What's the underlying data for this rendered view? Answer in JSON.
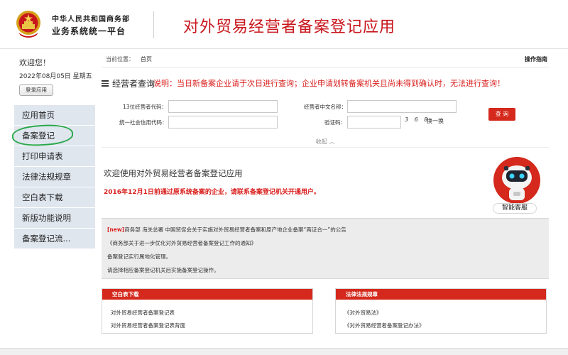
{
  "header": {
    "org_line1": "中华人民共和国商务部",
    "org_line2": "业务系统统一平台",
    "app_title": "对外贸易经营者备案登记应用"
  },
  "sidebar": {
    "welcome": "欢迎您！",
    "date": "2022年08月05日 星期五",
    "login_label": "登录应用",
    "items": [
      {
        "label": "应用首页"
      },
      {
        "label": "备案登记"
      },
      {
        "label": "打印申请表"
      },
      {
        "label": "法律法规规章"
      },
      {
        "label": "空白表下载"
      },
      {
        "label": "新版功能说明"
      },
      {
        "label": "备案登记流..."
      }
    ]
  },
  "breadcrumb": {
    "label": "当前位置：",
    "current": "首页",
    "guide": "操作指南"
  },
  "query": {
    "title": "经营者查询",
    "note": "说明：当日新备案企业请于次日进行查询；企业申请划转备案机关且尚未得到确认时，无法进行查询！",
    "fields": {
      "code13_label": "13位经营者代码：",
      "cn_name_label": "经营者中文名称：",
      "credit_code_label": "统一社会信用代码：",
      "captcha_label": "验证码："
    },
    "captcha_text": "3 6 8",
    "refresh_label": "换一换",
    "search_label": "查 询",
    "collapse_label": "收起 ︿"
  },
  "notice": {
    "title": "欢迎使用对外贸易经营者备案登记应用",
    "red_text": "2016年12月1日前通过原系统备案的企业，请联系备案登记机关开通用户。"
  },
  "assistant": {
    "label": "智能客服"
  },
  "news": {
    "new_tag": "[new]",
    "line1_text": "商务部 海关总署 中国贸促会关于实施对外贸易经营者备案和原产地企业备案“两证合一”的公告",
    "line2": "《商务部关于进一步优化对外贸易经营者备案登记工作的通知》",
    "line3": "备案登记实行属地化管理。",
    "line4": "请选择相应备案登记机关后实施备案登记操作。"
  },
  "panels": {
    "left": {
      "title": "空白表下载",
      "links": [
        "对外贸易经营者备案登记表",
        "对外贸易经营者备案登记表背面"
      ]
    },
    "right": {
      "title": "法律法规规章",
      "links": [
        "《对外贸易法》",
        "《对外贸易经营者备案登记办法》"
      ]
    }
  },
  "colors": {
    "brand_red": "#c8161d",
    "button_red": "#d4291c",
    "sidebar_bg": "#dfe6ee",
    "highlight_green": "#2aa84a"
  }
}
